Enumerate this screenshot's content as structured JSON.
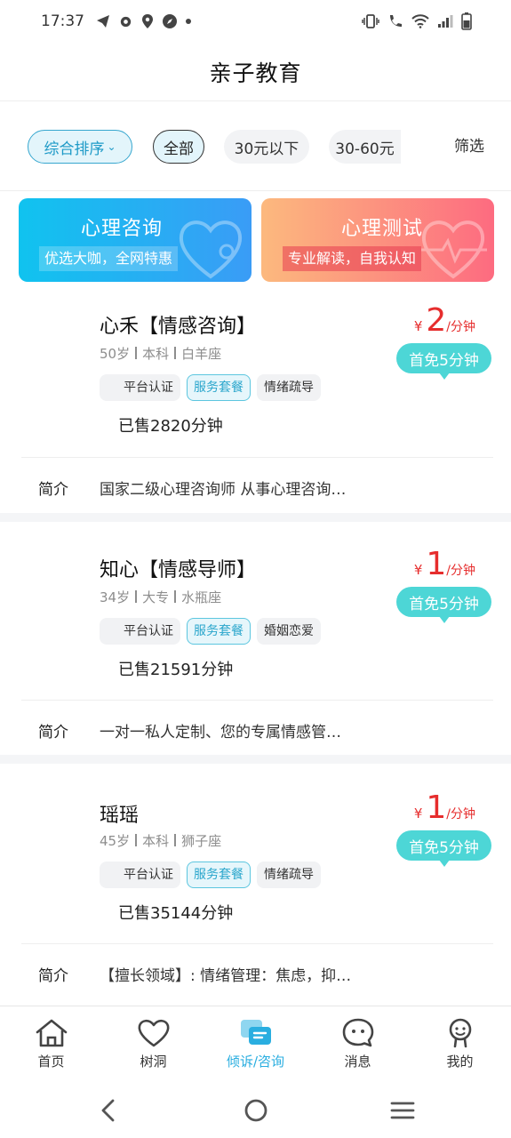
{
  "status_bar": {
    "time": "17:37",
    "icons_left": [
      "telegram-icon",
      "gear-icon",
      "location-icon",
      "compass-icon",
      "dot-icon"
    ],
    "icons_right": [
      "vibrate-icon",
      "wifi-call-icon",
      "wifi-icon",
      "signal-icon",
      "battery-icon"
    ]
  },
  "header": {
    "title": "亲子教育"
  },
  "filters": {
    "sort_label": "综合排序",
    "chips": [
      "全部",
      "30元以下",
      "30-60元"
    ],
    "filter_label": "筛选"
  },
  "banners": [
    {
      "title": "心理咨询",
      "subtitle": "优选大咖，全网特惠"
    },
    {
      "title": "心理测试",
      "subtitle": "专业解读，自我认知"
    }
  ],
  "counselors": [
    {
      "name": "心禾【情感咨询】",
      "age": "50岁",
      "education": "本科",
      "zodiac": "白羊座",
      "tags": [
        "平台认证",
        "服务套餐",
        "情绪疏导"
      ],
      "sold": "已售2820分钟",
      "price_currency": "¥",
      "price_value": "2",
      "price_unit": "/分钟",
      "free_badge": "首免5分钟",
      "intro_label": "简介",
      "intro": "国家二级心理咨询师 从事心理咨询…"
    },
    {
      "name": "知心【情感导师】",
      "age": "34岁",
      "education": "大专",
      "zodiac": "水瓶座",
      "tags": [
        "平台认证",
        "服务套餐",
        "婚姻恋爱"
      ],
      "sold": "已售21591分钟",
      "price_currency": "¥",
      "price_value": "1",
      "price_unit": "/分钟",
      "free_badge": "首免5分钟",
      "intro_label": "简介",
      "intro": "一对一私人定制、您的专属情感管…"
    },
    {
      "name": "瑶瑶",
      "age": "45岁",
      "education": "本科",
      "zodiac": "狮子座",
      "tags": [
        "平台认证",
        "服务套餐",
        "情绪疏导"
      ],
      "sold": "已售35144分钟",
      "price_currency": "¥",
      "price_value": "1",
      "price_unit": "/分钟",
      "free_badge": "首免5分钟",
      "intro_label": "简介",
      "intro": "【擅长领域】: 情绪管理：焦虑，抑…"
    }
  ],
  "bottom_nav": {
    "items": [
      {
        "label": "首页",
        "icon": "home-icon"
      },
      {
        "label": "树洞",
        "icon": "heart-icon"
      },
      {
        "label": "倾诉/咨询",
        "icon": "chat-icon",
        "active": true
      },
      {
        "label": "消息",
        "icon": "message-icon"
      },
      {
        "label": "我的",
        "icon": "profile-icon"
      }
    ]
  },
  "colors": {
    "accent": "#2aaee0",
    "price": "#e62d2d",
    "free_badge": "#4dd6d6",
    "consult_banner": "#10c3ef",
    "test_banner": "#fd6b80"
  }
}
